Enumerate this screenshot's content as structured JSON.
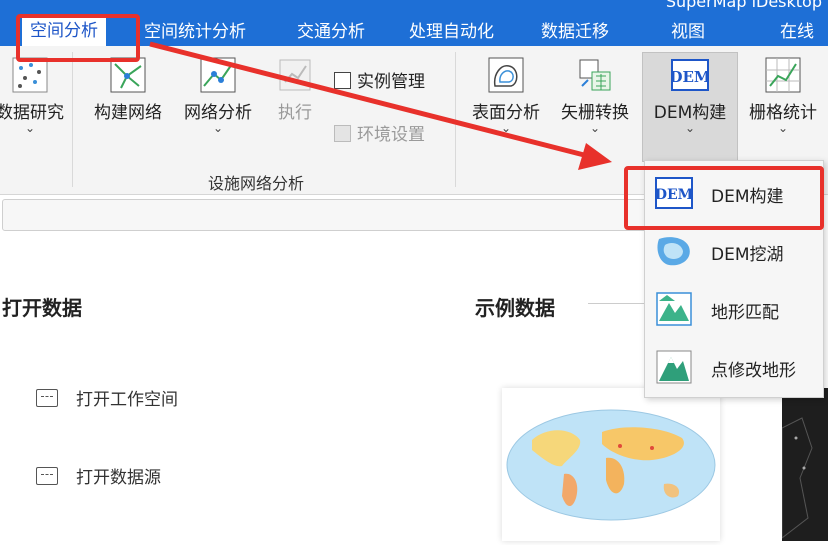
{
  "app": {
    "title": "SuperMap iDesktop"
  },
  "tabs": [
    {
      "label": "空间分析",
      "active": true
    },
    {
      "label": "空间统计分析"
    },
    {
      "label": "交通分析"
    },
    {
      "label": "处理自动化"
    },
    {
      "label": "数据迁移"
    },
    {
      "label": "视图"
    },
    {
      "label": "在线"
    }
  ],
  "ribbon": {
    "data_research": "数据研究",
    "build_network": "构建网络",
    "network_analysis": "网络分析",
    "execute": "执行",
    "instance_manage": "实例管理",
    "env_settings": "环境设置",
    "group_facility": "设施网络分析",
    "surface_analysis": "表面分析",
    "vector_raster": "矢栅转换",
    "dem_build": "DEM构建",
    "grid_stats": "栅格统计",
    "dem_icon_text": "DEM"
  },
  "dropdown": {
    "items": [
      {
        "label": "DEM构建",
        "icon": "dem-icon"
      },
      {
        "label": "DEM挖湖",
        "icon": "lake-icon"
      },
      {
        "label": "地形匹配",
        "icon": "terrain-match-icon"
      },
      {
        "label": "点修改地形",
        "icon": "point-terrain-icon"
      }
    ]
  },
  "start": {
    "open_data": "打开数据",
    "sample_data": "示例数据",
    "open_workspace": "打开工作空间",
    "open_datasource": "打开数据源"
  },
  "colors": {
    "accent": "#1e6fd6",
    "highlight": "#e8312b"
  }
}
